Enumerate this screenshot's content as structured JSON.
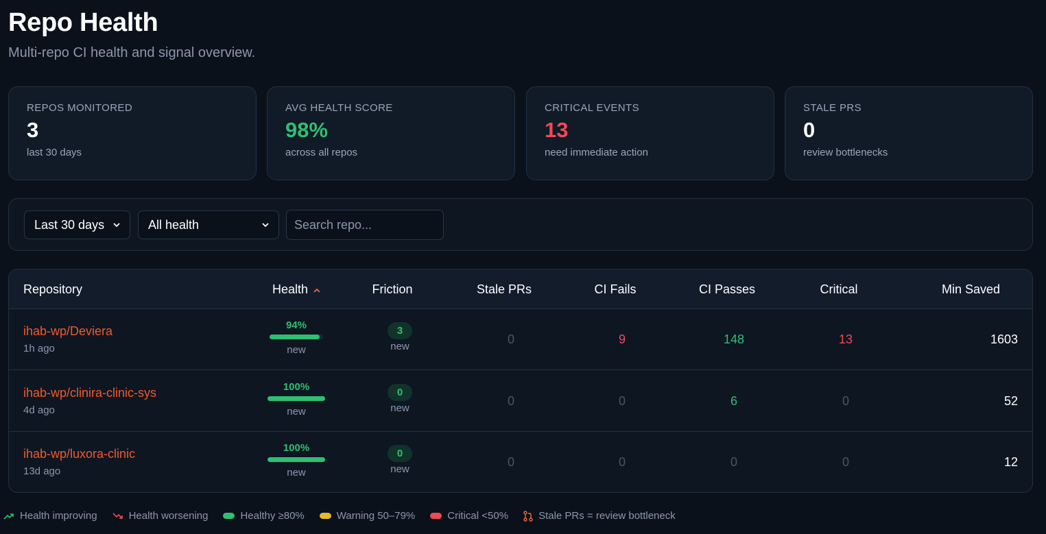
{
  "header": {
    "title": "Repo Health",
    "subtitle": "Multi-repo CI health and signal overview."
  },
  "stats": [
    {
      "label": "REPOS MONITORED",
      "value": "3",
      "note": "last 30 days",
      "color": "#ffffff"
    },
    {
      "label": "AVG HEALTH SCORE",
      "value": "98%",
      "note": "across all repos",
      "color": "#2fbf71"
    },
    {
      "label": "CRITICAL EVENTS",
      "value": "13",
      "note": "need immediate action",
      "color": "#f04a55"
    },
    {
      "label": "STALE PRS",
      "value": "0",
      "note": "review bottlenecks",
      "color": "#ffffff"
    }
  ],
  "filters": {
    "period": "Last 30 days",
    "health": "All health",
    "search_placeholder": "Search repo..."
  },
  "table": {
    "columns": [
      "Repository",
      "Health",
      "Friction",
      "Stale PRs",
      "CI Fails",
      "CI Passes",
      "Critical",
      "Min Saved"
    ],
    "sort_column": "Health",
    "sort_direction": "ascending",
    "rows": [
      {
        "repo": "ihab-wp/Deviera",
        "updated": "1h ago",
        "health": "94%",
        "health_value": 94,
        "health_note": "new",
        "friction": "3",
        "friction_note": "new",
        "stale_prs": "0",
        "ci_fails": "9",
        "ci_passes": "148",
        "critical": "13",
        "min_saved": "1603"
      },
      {
        "repo": "ihab-wp/clinira-clinic-sys",
        "updated": "4d ago",
        "health": "100%",
        "health_value": 100,
        "health_note": "new",
        "friction": "0",
        "friction_note": "new",
        "stale_prs": "0",
        "ci_fails": "0",
        "ci_passes": "6",
        "critical": "0",
        "min_saved": "52"
      },
      {
        "repo": "ihab-wp/luxora-clinic",
        "updated": "13d ago",
        "health": "100%",
        "health_value": 100,
        "health_note": "new",
        "friction": "0",
        "friction_note": "new",
        "stale_prs": "0",
        "ci_fails": "0",
        "ci_passes": "0",
        "critical": "0",
        "min_saved": "12"
      }
    ]
  },
  "legend": {
    "improving": "Health improving",
    "worsening": "Health worsening",
    "healthy": "Healthy ≥80%",
    "warning": "Warning 50–79%",
    "critical": "Critical <50%",
    "stale": "Stale PRs = review bottleneck"
  },
  "colors": {
    "accent": "#f15a2b",
    "healthy": "#2fbf71",
    "warning": "#e5b72e",
    "critical": "#f04a55",
    "background": "#0b111b"
  }
}
